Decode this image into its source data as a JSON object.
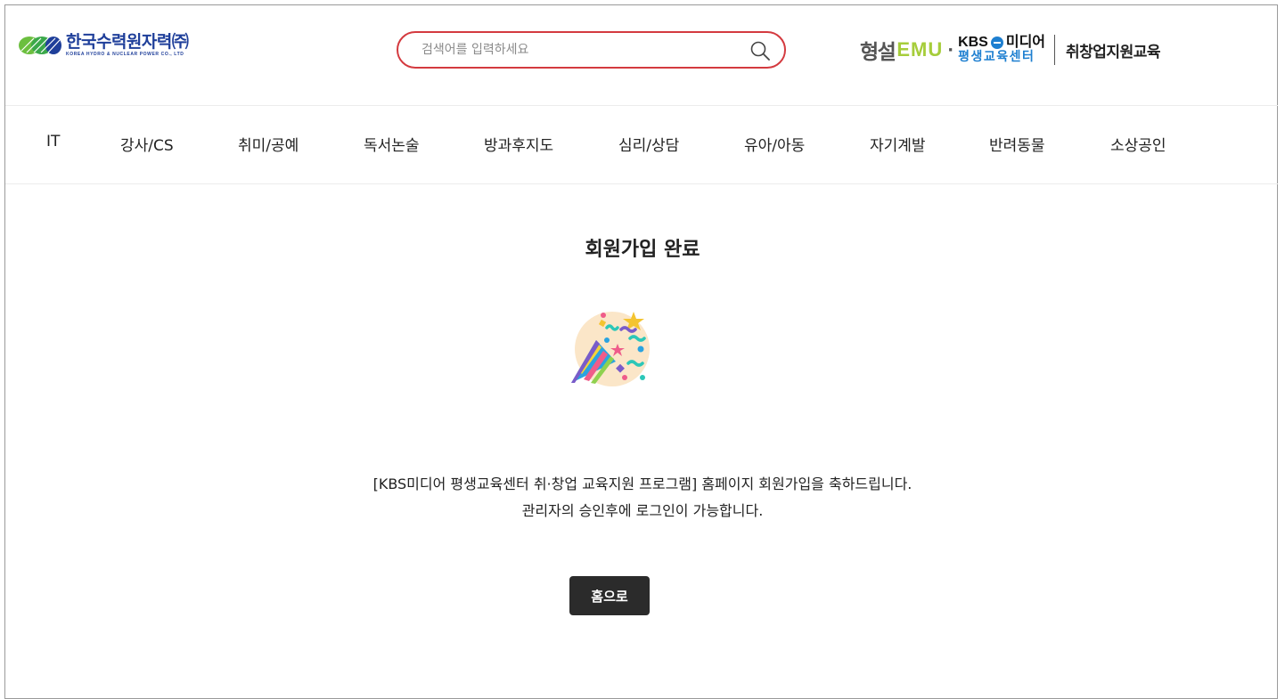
{
  "header": {
    "logo_khnp_ko": "한국수력원자력㈜",
    "logo_khnp_en": "KOREA HYDRO & NUCLEAR POWER CO., LTD",
    "search_placeholder": "검색어를 입력하세요",
    "brand_hyungseol": "형설",
    "brand_emu": "EMU",
    "brand_dot": "·",
    "brand_kbs": "KBS",
    "brand_kbs_media": "미디어",
    "brand_kbs_center": "평생교육센터",
    "brand_edu": "취창업지원교육"
  },
  "nav": {
    "items": [
      "IT",
      "강사/CS",
      "취미/공예",
      "독서논술",
      "방과후지도",
      "심리/상담",
      "유아/아동",
      "자기계발",
      "반려동물",
      "소상공인"
    ]
  },
  "main": {
    "title": "회원가입 완료",
    "message_line1": "[KBS미디어 평생교육센터 취·창업 교육지원 프로그램] 홈페이지 회원가입을 축하드립니다.",
    "message_line2": "관리자의 승인후에 로그인이 가능합니다.",
    "home_button": "홈으로"
  },
  "colors": {
    "search_border": "#d43a3f",
    "khnp_blue": "#1f3f9a",
    "kbs_blue": "#1e7fd0",
    "emu_green": "#a6cd3b",
    "button_bg": "#2b2b2b"
  },
  "icons": {
    "search": "search-icon",
    "party": "party-popper-icon",
    "khnp_logo": "khnp-logo-icon"
  }
}
